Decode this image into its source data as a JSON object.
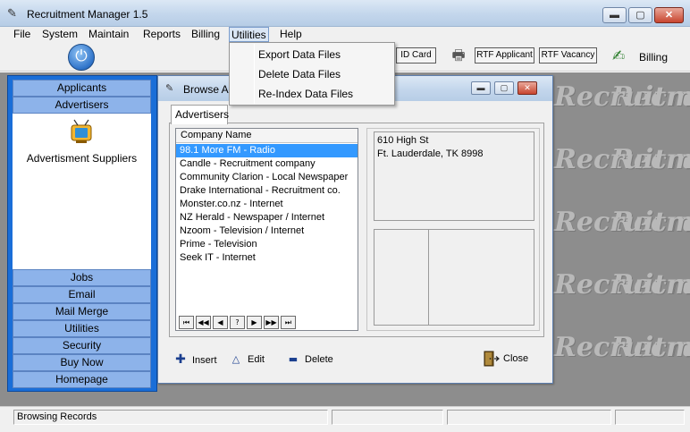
{
  "window": {
    "title": "Recruitment Manager 1.5",
    "controls": {
      "minimize": "▬",
      "maximize": "▢",
      "close": "✕"
    }
  },
  "menubar": {
    "items": [
      "File",
      "System",
      "Maintain",
      "Reports",
      "Billing",
      "Utilities",
      "Help"
    ],
    "open_menu": "Utilities"
  },
  "utilities_menu": {
    "items": [
      "Export Data Files",
      "Delete Data Files",
      "Re-Index Data Files"
    ]
  },
  "toolbar": {
    "id_card": "ID Card",
    "rtf_applicant": "RTF Applicant",
    "rtf_vacancy": "RTF Vacancy",
    "billing": "Billing"
  },
  "sidebar": {
    "top_items": [
      "Applicants",
      "Advertisers"
    ],
    "section_label": "Advertisment Suppliers",
    "bottom_items": [
      "Jobs",
      "Email",
      "Mail Merge",
      "Utilities",
      "Security",
      "Buy Now",
      "Homepage"
    ]
  },
  "child_window": {
    "title": "Browse A",
    "tab": "Advertisers",
    "list": {
      "header": "Company Name",
      "selected_index": 0,
      "rows": [
        "98.1 More FM - Radio",
        "Candle - Recruitment company",
        "Community Clarion - Local Newspaper",
        "Drake International - Recruitment co.",
        "Monster.co.nz - Internet",
        "NZ Herald - Newspaper / Internet",
        "Nzoom - Television / Internet",
        "Prime - Television",
        "Seek IT - Internet"
      ],
      "navigator": [
        "⏮",
        "◀◀",
        "◀",
        "?",
        "▶",
        "▶▶",
        "⏭"
      ]
    },
    "address_lines": [
      "610 High St",
      "Ft. Lauderdale, TK  8998"
    ],
    "actions": {
      "insert": "Insert",
      "edit": "Edit",
      "delete": "Delete",
      "close": "Close"
    }
  },
  "background": {
    "watermark": "Recruitm"
  },
  "statusbar": {
    "text": "Browsing Records"
  },
  "colors": {
    "sidebar_frame": "#1a6ed8",
    "nav_button": "#8db3ea",
    "selection": "#3399ff",
    "workspace": "#8d8d8d"
  }
}
